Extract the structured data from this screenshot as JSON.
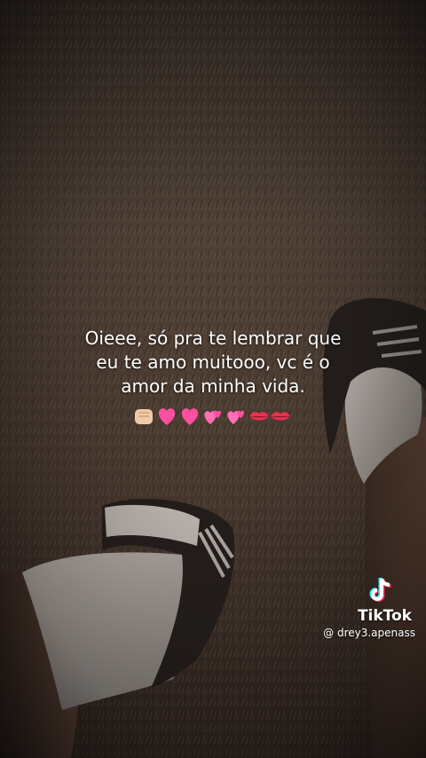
{
  "caption": {
    "line1": "Oieee, só pra te lembrar que",
    "line2": "eu te amo muitooo, vc é o",
    "line3": "amor da minha vida."
  },
  "emoji_row": [
    "fist-bump",
    "growing-heart",
    "growing-heart",
    "two-hearts",
    "two-hearts",
    "lips",
    "lips"
  ],
  "watermark": {
    "brand": "TikTok",
    "handle": "@ drey3.apenass"
  },
  "colors": {
    "ground": "#4a3b31",
    "grass_dark": "#2a211c",
    "sock": "#c9c4bf",
    "shoe": "#1b1816",
    "heart": "#ff4fa3",
    "tiktok_cyan": "#25f4ee",
    "tiktok_red": "#fe2c55"
  }
}
